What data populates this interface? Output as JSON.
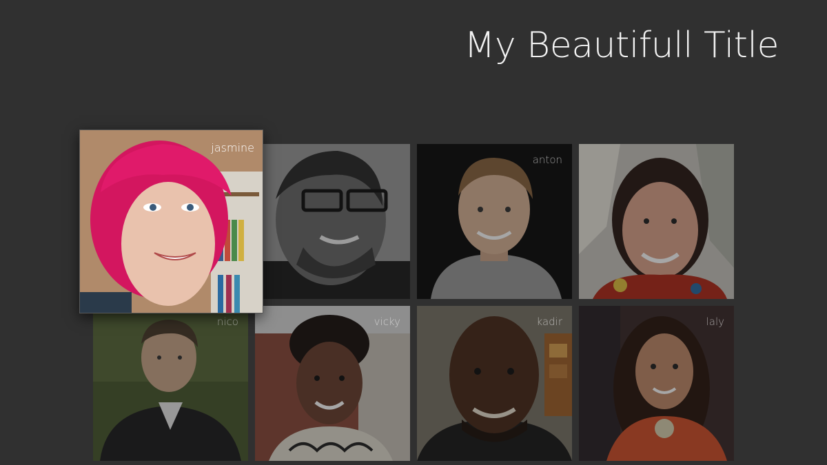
{
  "title": "My Beautifull Title",
  "people": [
    {
      "name": "jasmine",
      "focused": true
    },
    {
      "name": "",
      "focused": false
    },
    {
      "name": "anton",
      "focused": false
    },
    {
      "name": "",
      "focused": false
    },
    {
      "name": "nico",
      "focused": false
    },
    {
      "name": "vicky",
      "focused": false
    },
    {
      "name": "kadir",
      "focused": false
    },
    {
      "name": "laly",
      "focused": false
    }
  ]
}
